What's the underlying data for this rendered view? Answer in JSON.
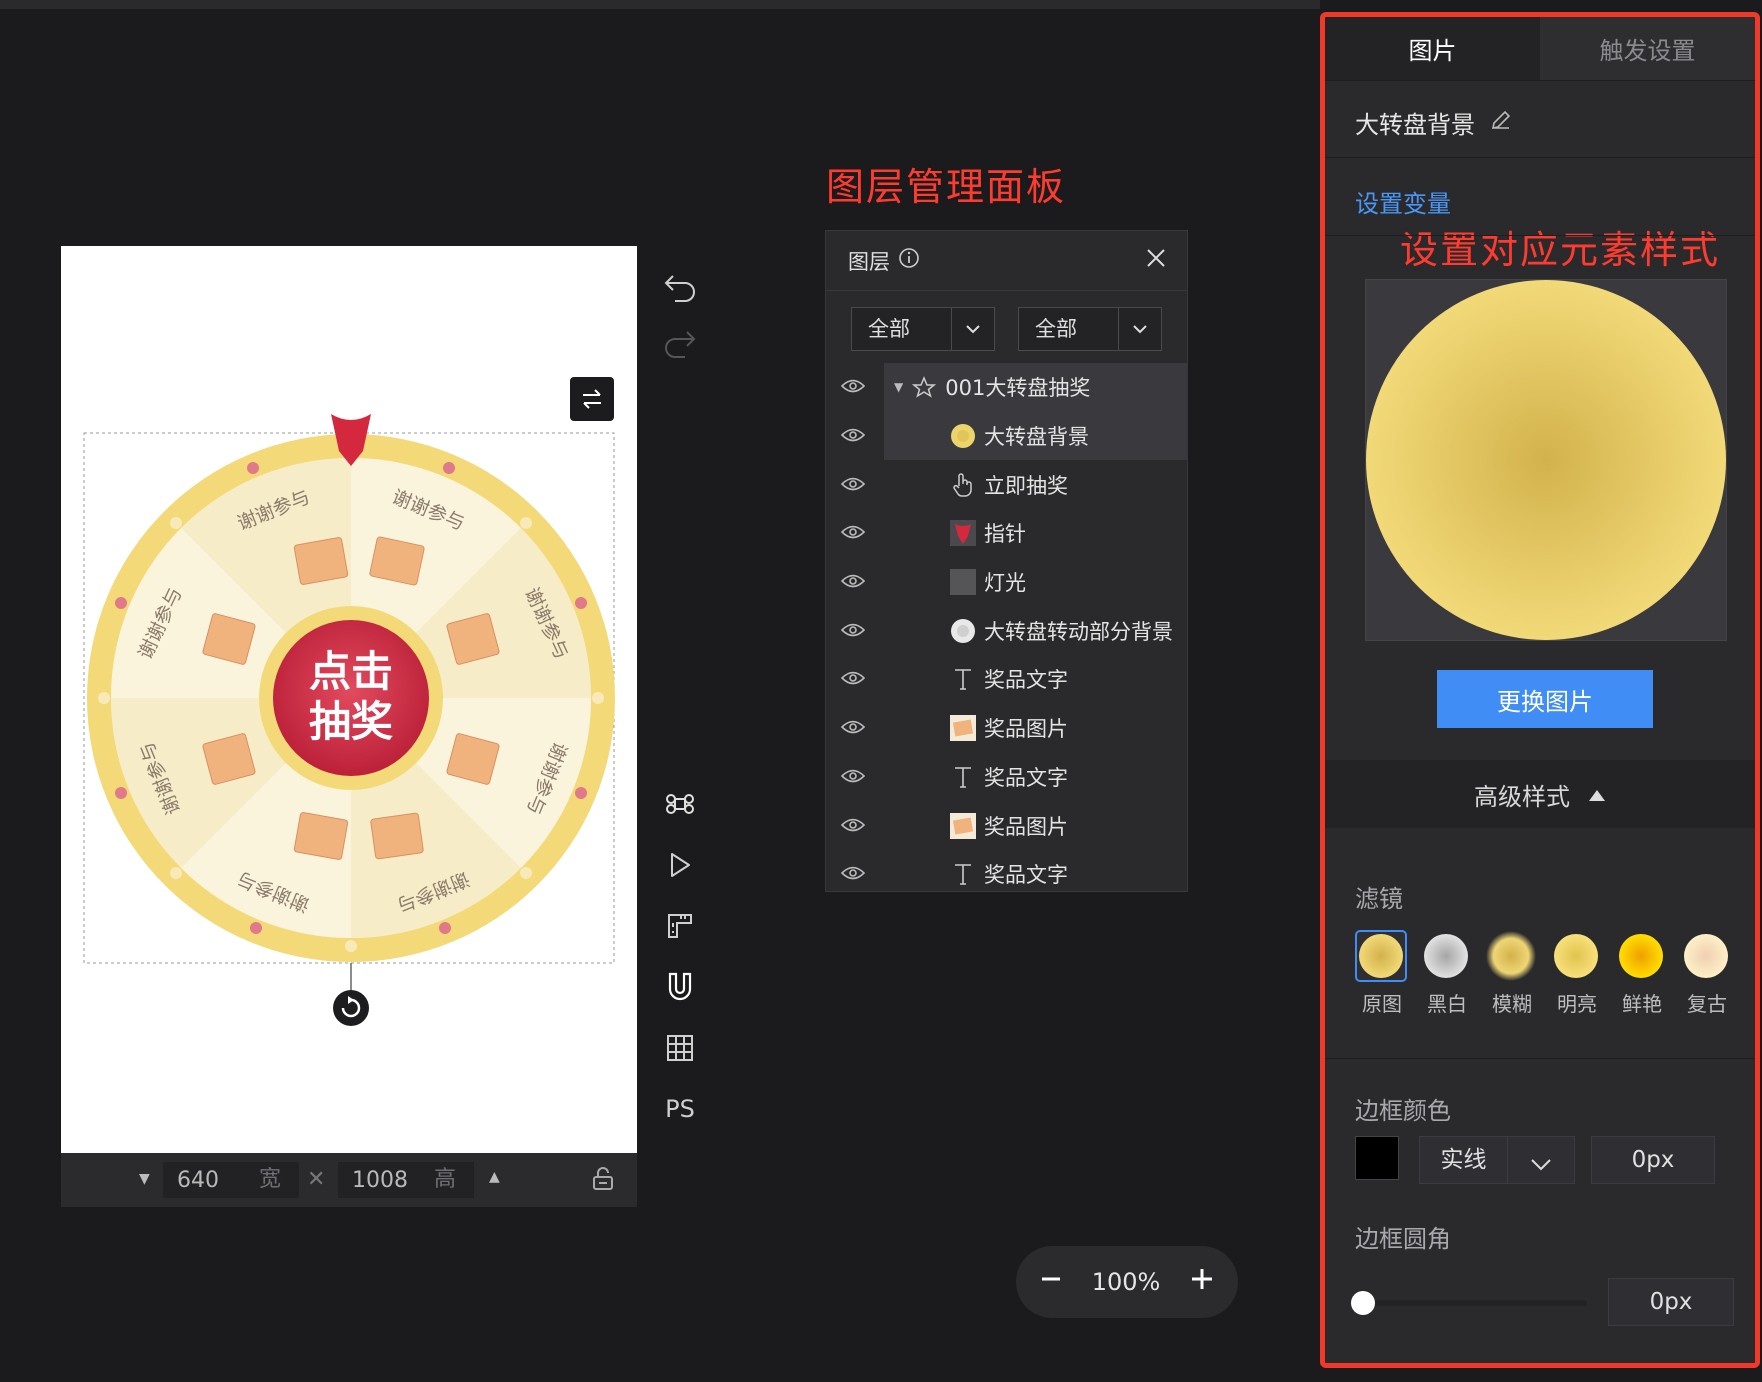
{
  "annotations": {
    "layer_panel": "图层管理面板",
    "element_style": "设置对应元素样式"
  },
  "canvas": {
    "width": "640",
    "width_label": "宽",
    "height": "1008",
    "height_label": "高",
    "wheel": {
      "center_label_line1": "点击",
      "center_label_line2": "抽奖",
      "segment_text": "谢谢参与"
    }
  },
  "toolbar": {
    "ps_label": "PS"
  },
  "layer_panel": {
    "title": "图层",
    "filter_1": "全部",
    "filter_2": "全部",
    "items": [
      {
        "label": "001大转盘抽奖",
        "icon": "group-icon"
      },
      {
        "label": "大转盘背景",
        "icon": "image-thumb"
      },
      {
        "label": "立即抽奖",
        "icon": "hand-pointer-icon"
      },
      {
        "label": "指针",
        "icon": "pointer-thumb"
      },
      {
        "label": "灯光",
        "icon": "light-thumb"
      },
      {
        "label": "大转盘转动部分背景",
        "icon": "wheel-thumb"
      },
      {
        "label": "奖品文字",
        "icon": "text-icon"
      },
      {
        "label": "奖品图片",
        "icon": "box-thumb"
      },
      {
        "label": "奖品文字",
        "icon": "text-icon"
      },
      {
        "label": "奖品图片",
        "icon": "box-thumb"
      },
      {
        "label": "奖品文字",
        "icon": "text-icon"
      }
    ]
  },
  "right_panel": {
    "tabs": [
      "图片",
      "触发设置"
    ],
    "element_name": "大转盘背景",
    "set_variable": "设置变量",
    "replace_image": "更换图片",
    "advanced_style": "高级样式",
    "filter_label": "滤镜",
    "filters": [
      "原图",
      "黑白",
      "模糊",
      "明亮",
      "鲜艳",
      "复古"
    ],
    "border_color_label": "边框颜色",
    "border_style": "实线",
    "border_width": "0px",
    "border_radius_label": "边框圆角",
    "border_radius": "0px",
    "border_radius_slider": 0
  },
  "zoom": {
    "value": "100%"
  },
  "colors": {
    "accent": "#3f8df5",
    "annotation": "#ff3b2f",
    "wheel_gold": "#f2d77a",
    "button_red": "#d4283f"
  }
}
